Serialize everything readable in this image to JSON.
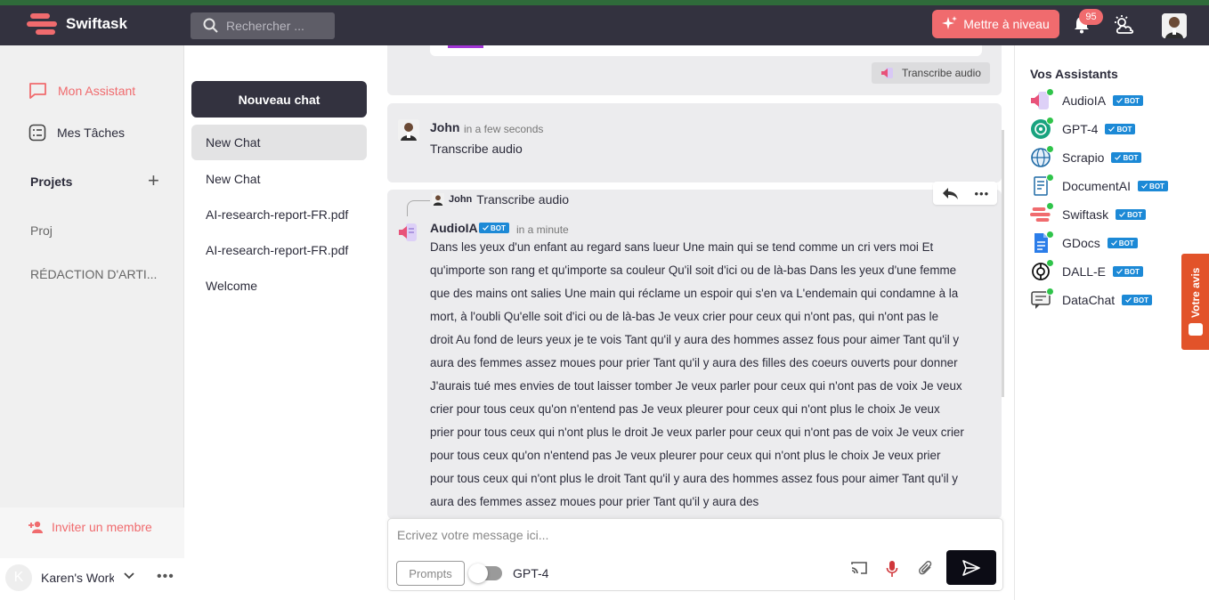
{
  "app": {
    "name": "Swiftask",
    "search_placeholder": "Rechercher ...",
    "upgrade_label": "Mettre à niveau",
    "notifications_count": "95",
    "brand_color": "#f06b6e",
    "topbar_color": "#33323f"
  },
  "sidebar": {
    "mon_assistant": "Mon Assistant",
    "mes_taches": "Mes Tâches",
    "projets_title": "Projets",
    "projects": [
      "Proj",
      "RÉDACTION D'ARTI..."
    ],
    "invite_label": "Inviter un membre",
    "workspace_initial": "K",
    "workspace_name": "Karen's Work"
  },
  "chats": {
    "new_button": "Nouveau chat",
    "items": [
      "New Chat",
      "New Chat",
      "AI-research-report-FR.pdf",
      "AI-research-report-FR.pdf",
      "Welcome"
    ]
  },
  "conversation": {
    "prev_pill": "Transcribe audio",
    "user_msg": {
      "name": "John",
      "time": "in a few seconds",
      "text": "Transcribe audio"
    },
    "ai_msg": {
      "reply_to_name": "John",
      "reply_to_text": "Transcribe audio",
      "name": "AudioIA",
      "badge": "BOT",
      "time": "in a minute",
      "text": "Dans les yeux d'un enfant au regard sans lueur Une main qui se tend comme un cri vers moi Et qu'importe son rang et qu'importe sa couleur Qu'il soit d'ici ou de là-bas Dans les yeux d'une femme que des mains ont salies Une main qui réclame un espoir qui s'en va L'endemain qui condamne à la mort, à l'oubli Qu'elle soit d'ici ou de là-bas Je veux crier pour ceux qui n'ont pas, qui n'ont pas le droit Au fond de leurs yeux je te vois Tant qu'il y aura des hommes assez fous pour aimer Tant qu'il y aura des femmes assez moues pour prier Tant qu'il y aura des filles des coeurs ouverts pour donner J'aurais tué mes envies de tout laisser tomber Je veux parler pour ceux qui n'ont pas de voix Je veux crier pour tous ceux qu'on n'entend pas Je veux pleurer pour ceux qui n'ont plus le choix Je veux prier pour tous ceux qui n'ont plus le droit Je veux parler pour ceux qui n'ont pas de voix Je veux crier pour tous ceux qu'on n'entend pas Je veux pleurer pour ceux qui n'ont plus le choix Je veux prier pour tous ceux qui n'ont plus le droit Tant qu'il y aura des hommes assez fous pour aimer Tant qu'il y aura des femmes assez moues pour prier Tant qu'il y aura des"
    }
  },
  "composer": {
    "placeholder": "Ecrivez votre message ici...",
    "prompts_label": "Prompts",
    "model": "GPT-4"
  },
  "assistants": {
    "title": "Vos Assistants",
    "badge": "BOT",
    "items": [
      "AudioIA",
      "GPT-4",
      "Scrapio",
      "DocumentAI",
      "Swiftask",
      "GDocs",
      "DALL-E",
      "DataChat"
    ]
  },
  "feedback": {
    "label": "Votre avis"
  }
}
